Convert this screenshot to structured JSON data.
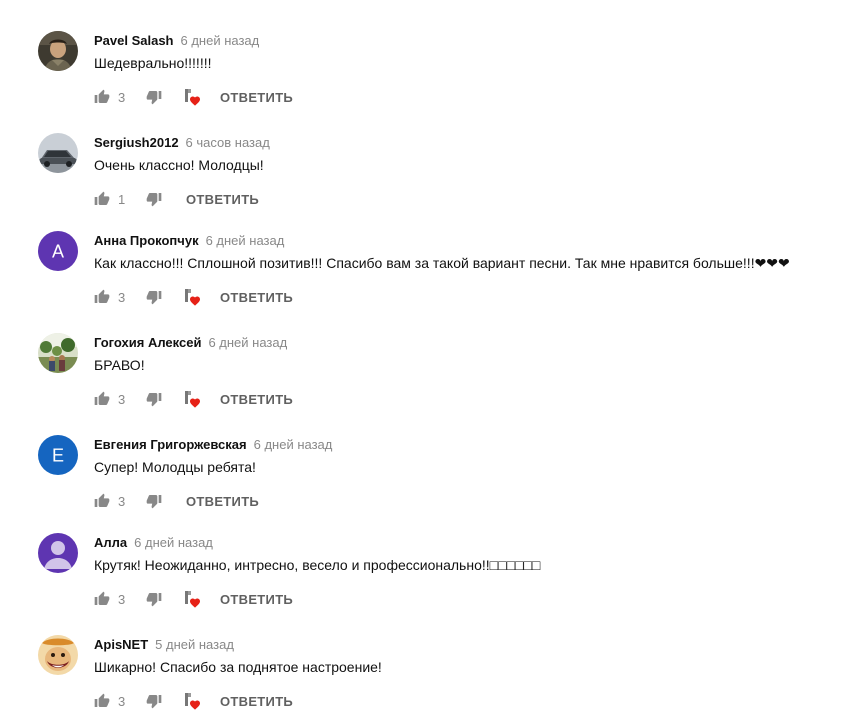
{
  "reply_label": "ОТВЕТИТЬ",
  "colors": {
    "heart": "#e62117",
    "icon": "#888888",
    "author": "#111111",
    "meta": "#888888"
  },
  "comments": [
    {
      "author": "Pavel Salash",
      "time": "6 дней назад",
      "text": "Шедеврально!!!!!!!",
      "likes": "3",
      "creator_heart": true,
      "avatar": "photo-man"
    },
    {
      "author": "Sergiush2012",
      "time": "6 часов назад",
      "text": "Очень классно! Молодцы!",
      "likes": "1",
      "creator_heart": false,
      "avatar": "photo-car"
    },
    {
      "author": "Анна Прокопчук",
      "time": "6 дней назад",
      "text": "Как классно!!! Сплошной позитив!!! Спасибо вам за такой вариант песни. Так мне нравится больше!!!❤❤❤",
      "likes": "3",
      "creator_heart": true,
      "avatar": "letter",
      "avatar_letter": "A",
      "avatar_color": "#5e35b1"
    },
    {
      "author": "Гогохия Алексей",
      "time": "6 дней назад",
      "text": "БРАВО!",
      "likes": "3",
      "creator_heart": true,
      "avatar": "photo-garden"
    },
    {
      "author": "Евгения Григоржевская",
      "time": "6 дней назад",
      "text": "Супер! Молодцы ребята!",
      "likes": "3",
      "creator_heart": false,
      "avatar": "letter",
      "avatar_letter": "E",
      "avatar_color": "#1565c0"
    },
    {
      "author": "Алла",
      "time": "6 дней назад",
      "text": "Крутяк! Неожиданно, интресно, весело и профессионально!!□□□□□□",
      "likes": "3",
      "creator_heart": true,
      "avatar": "default-person",
      "avatar_color": "#5e35b1"
    },
    {
      "author": "ApisNET",
      "time": "5 дней назад",
      "text": "Шикарно! Спасибо за поднятое настроение!",
      "likes": "3",
      "creator_heart": true,
      "avatar": "photo-cartoon"
    }
  ]
}
